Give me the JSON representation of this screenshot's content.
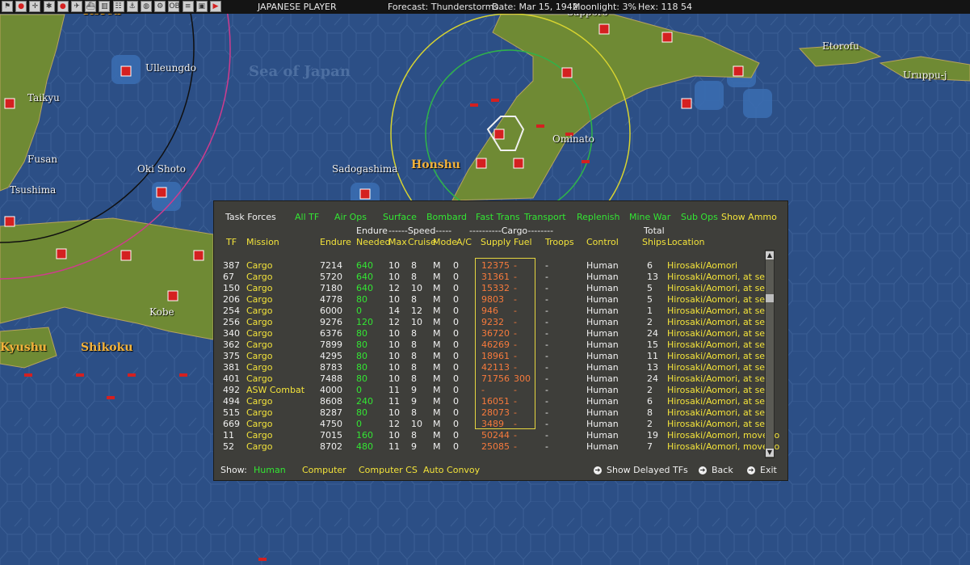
{
  "topbar": {
    "player": "JAPANESE PLAYER",
    "forecast": "Forecast: Thunderstorms",
    "date": "Date: Mar 15, 1942",
    "moonlight": "Moonlight: 3%",
    "hex": "Hex: 118 54",
    "icons": [
      "flag-icon",
      "japan-flag-icon",
      "compass-icon",
      "star-icon",
      "japan-flag-icon",
      "plane-icon",
      "ship-icon",
      "factory-icon",
      "group-icon",
      "port-icon",
      "globe-icon",
      "gear-icon",
      "ob-icon",
      "notes-icon",
      "save-icon",
      "play-icon"
    ]
  },
  "map": {
    "labels": {
      "korea": "Korea",
      "ulleungdo": "Ulleungdo",
      "sea_of_japan": "Sea of Japan",
      "taikyu": "Taikyu",
      "fusan": "Fusan",
      "tsushima": "Tsushima",
      "oki_shoto": "Oki Shoto",
      "sadogashima": "Sadogashima",
      "honshu": "Honshu",
      "ominato": "Ominato",
      "sapporo": "Sapporo",
      "etorofu": "Etorofu",
      "uruppu": "Uruppu-j",
      "kobe": "Kobe",
      "kyushu": "Kyushu",
      "shikoku": "Shikoku"
    }
  },
  "panel": {
    "tabs": {
      "task_forces": "Task Forces",
      "all_tf": "All TF",
      "air_ops": "Air Ops",
      "surface": "Surface",
      "bombard": "Bombard",
      "fast_trans": "Fast Trans",
      "transport": "Transport",
      "replenish": "Replenish",
      "mine_war": "Mine War",
      "sub_ops": "Sub Ops",
      "show_ammo": "Show Ammo"
    },
    "headers": {
      "endure_top": "Endure",
      "speed_group": "------Speed-----",
      "cargo_group": "----------Cargo--------",
      "total_top": "Total",
      "tf": "TF",
      "mission": "Mission",
      "endure": "Endure",
      "needed": "Needed",
      "max": "Max",
      "cruise": "Cruise",
      "mode": "Mode",
      "ac": "A/C",
      "supply": "Supply",
      "fuel": "Fuel",
      "troops": "Troops",
      "control": "Control",
      "ships": "Ships",
      "location": "Location"
    },
    "rows": [
      {
        "tf": "387",
        "mission": "Cargo",
        "endure": "7214",
        "needed": "640",
        "max": "10",
        "cruise": "8",
        "mode": "M",
        "ac": "0",
        "supply": "12375",
        "fuel": "-",
        "troops": "-",
        "control": "Human",
        "ships": "6",
        "location": "Hirosaki/Aomori"
      },
      {
        "tf": "67",
        "mission": "Cargo",
        "endure": "5720",
        "needed": "640",
        "max": "10",
        "cruise": "8",
        "mode": "M",
        "ac": "0",
        "supply": "31361",
        "fuel": "-",
        "troops": "-",
        "control": "Human",
        "ships": "13",
        "location": "Hirosaki/Aomori, at sea"
      },
      {
        "tf": "150",
        "mission": "Cargo",
        "endure": "7180",
        "needed": "640",
        "max": "12",
        "cruise": "10",
        "mode": "M",
        "ac": "0",
        "supply": "15332",
        "fuel": "-",
        "troops": "-",
        "control": "Human",
        "ships": "5",
        "location": "Hirosaki/Aomori, at sea"
      },
      {
        "tf": "206",
        "mission": "Cargo",
        "endure": "4778",
        "needed": "80",
        "max": "10",
        "cruise": "8",
        "mode": "M",
        "ac": "0",
        "supply": "9803",
        "fuel": "-",
        "troops": "-",
        "control": "Human",
        "ships": "5",
        "location": "Hirosaki/Aomori, at sea"
      },
      {
        "tf": "254",
        "mission": "Cargo",
        "endure": "6000",
        "needed": "0",
        "max": "14",
        "cruise": "12",
        "mode": "M",
        "ac": "0",
        "supply": "946",
        "fuel": "-",
        "troops": "-",
        "control": "Human",
        "ships": "1",
        "location": "Hirosaki/Aomori, at sea"
      },
      {
        "tf": "256",
        "mission": "Cargo",
        "endure": "9276",
        "needed": "120",
        "max": "12",
        "cruise": "10",
        "mode": "M",
        "ac": "0",
        "supply": "9232",
        "fuel": "-",
        "troops": "-",
        "control": "Human",
        "ships": "2",
        "location": "Hirosaki/Aomori, at sea"
      },
      {
        "tf": "340",
        "mission": "Cargo",
        "endure": "6376",
        "needed": "80",
        "max": "10",
        "cruise": "8",
        "mode": "M",
        "ac": "0",
        "supply": "36720",
        "fuel": "-",
        "troops": "-",
        "control": "Human",
        "ships": "24",
        "location": "Hirosaki/Aomori, at sea"
      },
      {
        "tf": "362",
        "mission": "Cargo",
        "endure": "7899",
        "needed": "80",
        "max": "10",
        "cruise": "8",
        "mode": "M",
        "ac": "0",
        "supply": "46269",
        "fuel": "-",
        "troops": "-",
        "control": "Human",
        "ships": "15",
        "location": "Hirosaki/Aomori, at sea"
      },
      {
        "tf": "375",
        "mission": "Cargo",
        "endure": "4295",
        "needed": "80",
        "max": "10",
        "cruise": "8",
        "mode": "M",
        "ac": "0",
        "supply": "18961",
        "fuel": "-",
        "troops": "-",
        "control": "Human",
        "ships": "11",
        "location": "Hirosaki/Aomori, at sea"
      },
      {
        "tf": "381",
        "mission": "Cargo",
        "endure": "8783",
        "needed": "80",
        "max": "10",
        "cruise": "8",
        "mode": "M",
        "ac": "0",
        "supply": "42113",
        "fuel": "-",
        "troops": "-",
        "control": "Human",
        "ships": "13",
        "location": "Hirosaki/Aomori, at sea"
      },
      {
        "tf": "401",
        "mission": "Cargo",
        "endure": "7488",
        "needed": "80",
        "max": "10",
        "cruise": "8",
        "mode": "M",
        "ac": "0",
        "supply": "71756",
        "fuel": "300",
        "troops": "-",
        "control": "Human",
        "ships": "24",
        "location": "Hirosaki/Aomori, at sea"
      },
      {
        "tf": "492",
        "mission": "ASW Combat",
        "endure": "4000",
        "needed": "0",
        "max": "11",
        "cruise": "9",
        "mode": "M",
        "ac": "0",
        "supply": "-",
        "fuel": "-",
        "troops": "-",
        "control": "Human",
        "ships": "2",
        "location": "Hirosaki/Aomori, at sea"
      },
      {
        "tf": "494",
        "mission": "Cargo",
        "endure": "8608",
        "needed": "240",
        "max": "11",
        "cruise": "9",
        "mode": "M",
        "ac": "0",
        "supply": "16051",
        "fuel": "-",
        "troops": "-",
        "control": "Human",
        "ships": "6",
        "location": "Hirosaki/Aomori, at sea"
      },
      {
        "tf": "515",
        "mission": "Cargo",
        "endure": "8287",
        "needed": "80",
        "max": "10",
        "cruise": "8",
        "mode": "M",
        "ac": "0",
        "supply": "28073",
        "fuel": "-",
        "troops": "-",
        "control": "Human",
        "ships": "8",
        "location": "Hirosaki/Aomori, at sea"
      },
      {
        "tf": "669",
        "mission": "Cargo",
        "endure": "4750",
        "needed": "0",
        "max": "12",
        "cruise": "10",
        "mode": "M",
        "ac": "0",
        "supply": "3489",
        "fuel": "-",
        "troops": "-",
        "control": "Human",
        "ships": "2",
        "location": "Hirosaki/Aomori, at sea"
      },
      {
        "tf": "11",
        "mission": "Cargo",
        "endure": "7015",
        "needed": "160",
        "max": "10",
        "cruise": "8",
        "mode": "M",
        "ac": "0",
        "supply": "50244",
        "fuel": "-",
        "troops": "-",
        "control": "Human",
        "ships": "19",
        "location": "Hirosaki/Aomori, move to"
      },
      {
        "tf": "52",
        "mission": "Cargo",
        "endure": "8702",
        "needed": "480",
        "max": "11",
        "cruise": "9",
        "mode": "M",
        "ac": "0",
        "supply": "25085",
        "fuel": "-",
        "troops": "-",
        "control": "Human",
        "ships": "7",
        "location": "Hirosaki/Aomori, move to"
      }
    ],
    "footer": {
      "show_label": "Show:",
      "human": "Human",
      "computer": "Computer",
      "computer_cs": "Computer CS",
      "auto_convoy": "Auto Convoy",
      "show_delayed": "Show Delayed TFs",
      "back": "Back",
      "exit": "Exit"
    }
  },
  "colors": {
    "sea": "#2c4f86",
    "land": "#6f8a34",
    "panel_bg": "#3e3e3a",
    "green_text": "#33e533",
    "yellow_text": "#f3e33a",
    "orange_text": "#f77a3c",
    "unit_red": "#d42020"
  }
}
